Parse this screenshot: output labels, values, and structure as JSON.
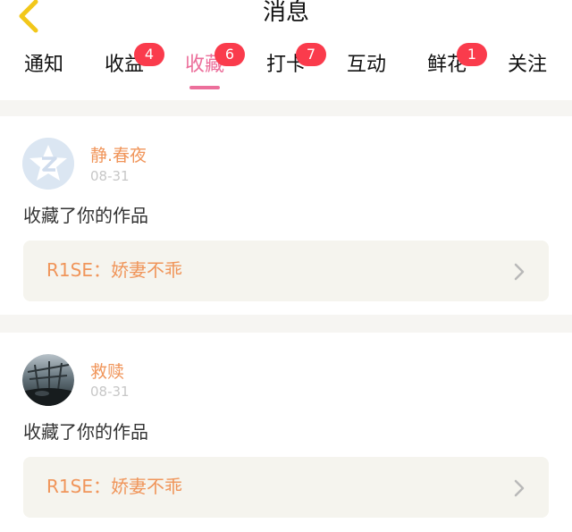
{
  "header": {
    "title": "消息",
    "back_icon": "chevron-left-icon",
    "back_color": "#f2c71a"
  },
  "tabs": [
    {
      "label": "通知",
      "badge": ""
    },
    {
      "label": "收益",
      "badge": "4"
    },
    {
      "label": "收藏",
      "badge": "6",
      "active": true
    },
    {
      "label": "打卡",
      "badge": "7"
    },
    {
      "label": "互动",
      "badge": ""
    },
    {
      "label": "鲜花",
      "badge": "1"
    },
    {
      "label": "关注",
      "badge": ""
    }
  ],
  "colors": {
    "accent": "#ec6f9b",
    "badge": "#fa3b4c",
    "name": "#f0955a",
    "date": "#c7c7c7",
    "card_bg": "#f5f4ee"
  },
  "messages": [
    {
      "user": "静.春夜",
      "date": "08-31",
      "action": "收藏了你的作品",
      "work": "R1SE：娇妻不乖",
      "avatar": "default-avatar"
    },
    {
      "user": "救赎",
      "date": "08-31",
      "action": "收藏了你的作品",
      "work": "R1SE：娇妻不乖",
      "avatar": "photo-avatar"
    }
  ]
}
